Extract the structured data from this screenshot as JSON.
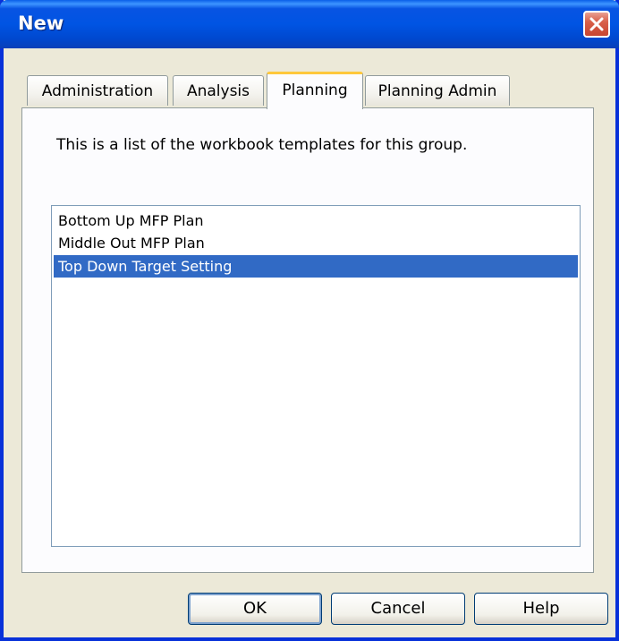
{
  "window": {
    "title": "New"
  },
  "tabs": [
    {
      "label": "Administration"
    },
    {
      "label": "Analysis"
    },
    {
      "label": "Planning",
      "active": true
    },
    {
      "label": "Planning Admin"
    }
  ],
  "panel": {
    "description": "This is a list of the workbook templates for this group.",
    "templates": [
      {
        "label": "Bottom Up MFP Plan"
      },
      {
        "label": "Middle Out MFP Plan"
      },
      {
        "label": "Top Down Target Setting",
        "selected": true
      }
    ]
  },
  "buttons": {
    "ok": "OK",
    "cancel": "Cancel",
    "help": "Help"
  },
  "colors": {
    "title_bar": "#0054E3",
    "selection": "#316AC5",
    "active_tab_accent": "#FFC83C",
    "close_button": "#C74531"
  },
  "icons": {
    "close": "close-icon"
  }
}
